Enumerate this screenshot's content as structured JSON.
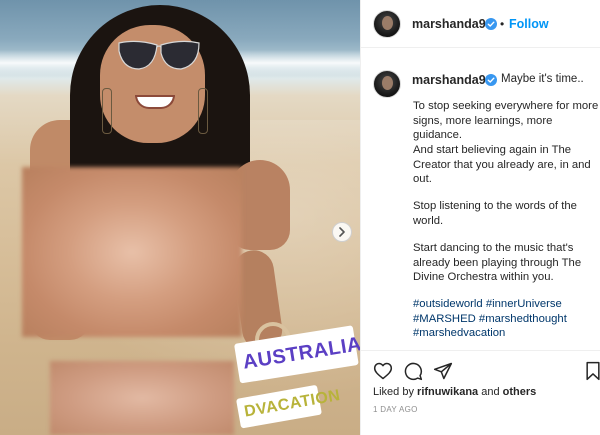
{
  "photo": {
    "sticker_top": "AUSTRALIA",
    "sticker_bottom": "DVACATION"
  },
  "header": {
    "username": "marshanda99",
    "separator": "•",
    "follow_label": "Follow"
  },
  "caption": {
    "username": "marshanda99",
    "first_line": "Maybe it's time..",
    "paragraphs": [
      "To stop seeking everywhere for more signs, more learnings, more guidance.",
      "And start believing again in The Creator that you already are, in and out.",
      "Stop listening to the words of the world.",
      "Start dancing to the music that's already been playing through The Divine Orchestra within you."
    ],
    "hashtags": "#outsideworld #innerUniverse #MARSHED #marshedthought #marshedvacation"
  },
  "likes": {
    "prefix": "Liked by",
    "user": "rifnuwikana",
    "conjunction": "and",
    "others": "others"
  },
  "timestamp": "1 DAY AGO",
  "icons": [
    "verified-badge-icon",
    "heart-icon",
    "comment-icon",
    "share-icon",
    "bookmark-icon",
    "chevron-right-icon"
  ],
  "colors": {
    "link_blue": "#0095f6",
    "hashtag_blue": "#00376b",
    "verified_blue": "#3897f0",
    "text": "#262626",
    "muted": "#8e8e8e"
  }
}
